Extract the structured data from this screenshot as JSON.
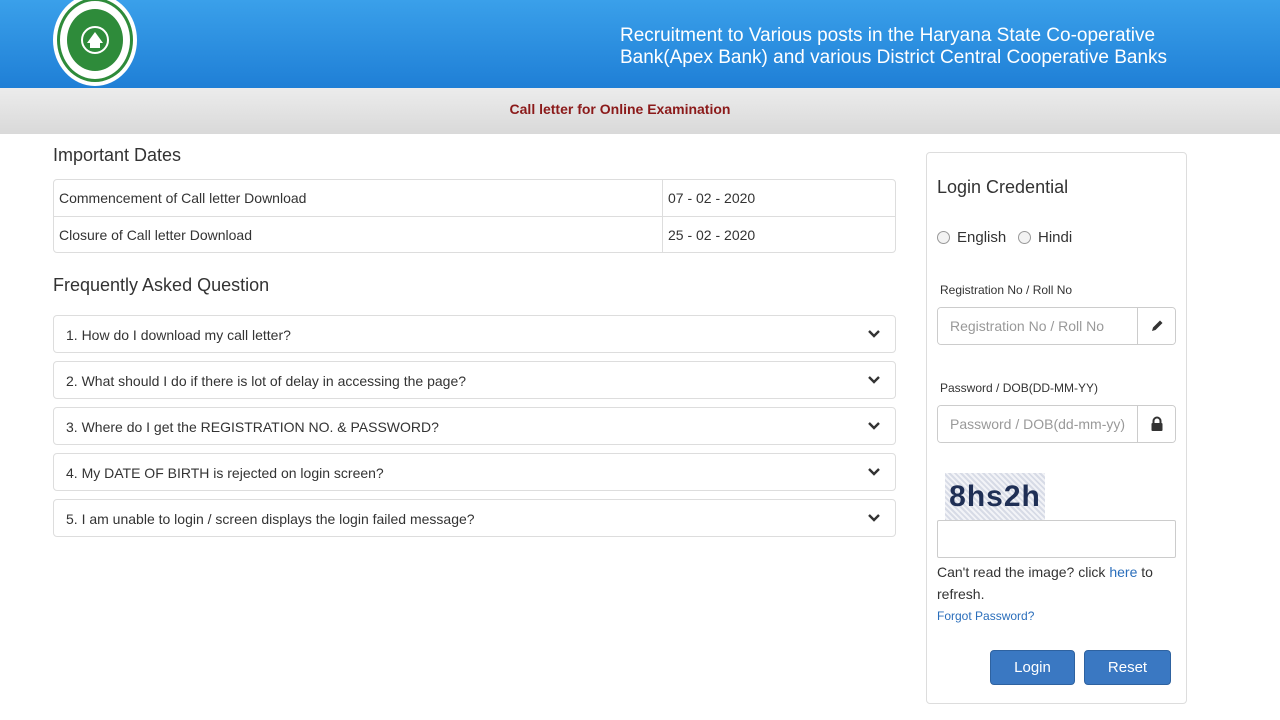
{
  "header": {
    "title_line1": "Recruitment to Various posts in the Haryana State Co-operative",
    "title_line2": "Bank(Apex Bank) and various District Central Cooperative Banks",
    "brand_color": "#2386dd"
  },
  "subbar": {
    "title": "Call letter for Online Examination",
    "title_color": "#8b1a1a"
  },
  "important_dates": {
    "heading": "Important Dates",
    "rows": [
      {
        "label": "Commencement of Call letter Download",
        "value": "07 - 02 - 2020"
      },
      {
        "label": "Closure of Call letter Download",
        "value": "25 - 02 - 2020"
      }
    ]
  },
  "faq": {
    "heading": "Frequently Asked Question",
    "items": [
      "1. How do I download my call letter?",
      "2. What should I do if there is lot of delay in accessing the page?",
      "3. Where do I get the REGISTRATION NO. & PASSWORD?",
      "4. My DATE OF BIRTH is rejected on login screen?",
      "5. I am unable to login / screen displays the login failed message?"
    ]
  },
  "login": {
    "title": "Login Credential",
    "lang_english": "English",
    "lang_hindi": "Hindi",
    "reg_label": "Registration No / Roll No",
    "reg_placeholder": "Registration No / Roll No",
    "reg_icon": "pencil-icon",
    "pwd_label": "Password / DOB(DD-MM-YY)",
    "pwd_placeholder": "Password / DOB(dd-mm-yy)",
    "pwd_icon": "lock-icon",
    "captcha_text": "8hs2h",
    "hint_prefix": "Can't read the image? click ",
    "hint_link": "here",
    "hint_suffix": " to refresh.",
    "forgot": "Forgot Password?",
    "login_button": "Login",
    "reset_button": "Reset",
    "button_color": "#3a78c2"
  }
}
